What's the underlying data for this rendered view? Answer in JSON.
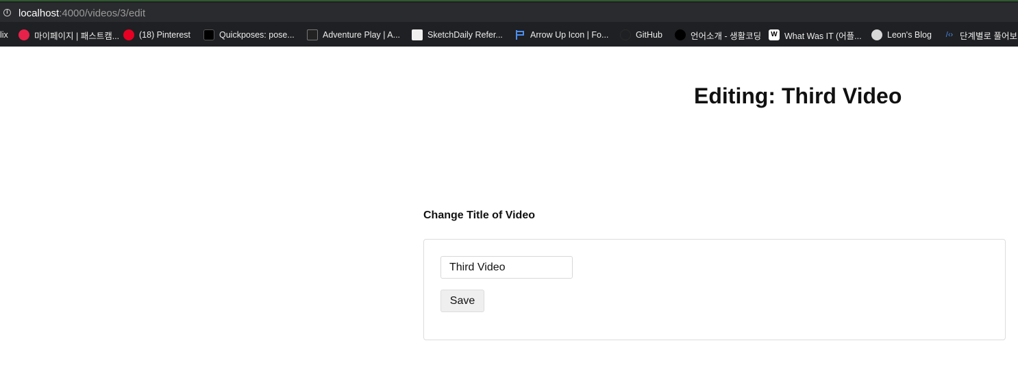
{
  "browser": {
    "url_host": "localhost",
    "url_rest": ":4000/videos/3/edit"
  },
  "bookmarks": [
    {
      "label": "lix",
      "icon": "none"
    },
    {
      "label": "마이페이지 | 패스트캠...",
      "icon": "fastcampus-icon"
    },
    {
      "label": "(18) Pinterest",
      "icon": "pinterest-icon"
    },
    {
      "label": "Quickposes: pose...",
      "icon": "quickposes-icon"
    },
    {
      "label": "Adventure Play | A...",
      "icon": "adventure-play-icon"
    },
    {
      "label": "SketchDaily Refer...",
      "icon": "sketchdaily-icon"
    },
    {
      "label": "Arrow Up Icon | Fo...",
      "icon": "flag-icon"
    },
    {
      "label": "GitHub",
      "icon": "github-icon"
    },
    {
      "label": "언어소개 - 생활코딩",
      "icon": "opentutorials-icon"
    },
    {
      "label": "What Was IT (어플...",
      "icon": "w-icon"
    },
    {
      "label": "Leon's Blog",
      "icon": "globe-icon"
    },
    {
      "label": "단계별로 풀어보기",
      "icon": "code-icon"
    }
  ],
  "page": {
    "title": "Editing: Third Video",
    "section_label": "Change Title of Video",
    "form": {
      "title_value": "Third Video",
      "save_label": "Save"
    }
  }
}
